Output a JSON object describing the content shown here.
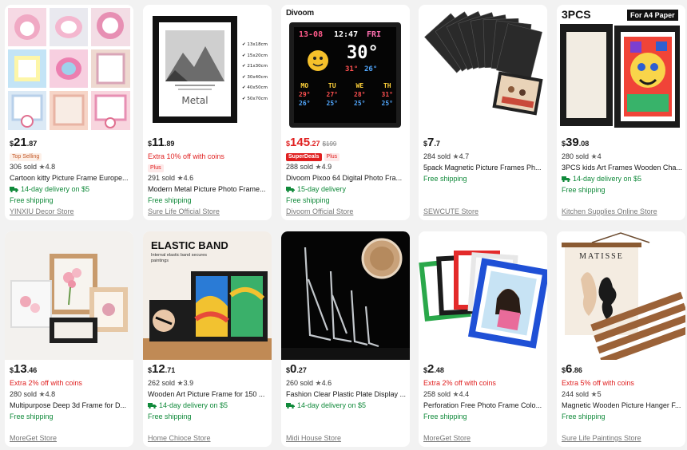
{
  "products": [
    {
      "price_cur": "$",
      "price_main": "21",
      "price_dec": ".87",
      "badges": [
        {
          "kind": "top",
          "text": "Top Selling"
        }
      ],
      "sold": "306 sold",
      "rating": "4.8",
      "title": "Cartoon kitty Picture Frame Europe...",
      "delivery": "14-day delivery on $5",
      "shipping": "Free shipping",
      "store": "YINXIU Decor Store",
      "image_icon": "cartoon-frames-image"
    },
    {
      "price_cur": "$",
      "price_main": "11",
      "price_dec": ".89",
      "promo": "Extra 10% off with coins",
      "badges": [
        {
          "kind": "plus",
          "text": "Plus"
        }
      ],
      "sold": "291 sold",
      "rating": "4.6",
      "title": "Modern Metal Picture Photo Frame...",
      "delivery": "",
      "shipping": "Free shipping",
      "store": "Sure Life Official Store",
      "image_icon": "metal-frame-image",
      "sizes": [
        "13x18cm",
        "15x20cm",
        "21x30cm",
        "30x40cm",
        "40x50cm",
        "50x70cm"
      ],
      "frame_caption": "Metal"
    },
    {
      "price_cur": "$",
      "price_main": "145",
      "price_dec": ".27",
      "price_orig": "$199",
      "price_red": true,
      "badges": [
        {
          "kind": "super",
          "text": "SuperDeals"
        },
        {
          "kind": "plus",
          "text": "Plus"
        }
      ],
      "sold": "288 sold",
      "rating": "4.9",
      "title": "Divoom Pixoo 64 Digital Photo Fra...",
      "delivery": "15-day delivery",
      "shipping": "Free shipping",
      "store": "Divoom Official Store",
      "image_icon": "pixel-display-image",
      "brand": "Divoom",
      "display": {
        "date": "13-08",
        "time": "12:47",
        "day": "FRI",
        "temp": "30°",
        "hi": "31°",
        "lo": "26°",
        "days": [
          "MO",
          "TU",
          "WE",
          "TH"
        ],
        "day_hi": [
          "29°",
          "27°",
          "28°",
          "31°"
        ],
        "day_lo": [
          "26°",
          "25°",
          "25°",
          "25°"
        ]
      }
    },
    {
      "price_cur": "$",
      "price_main": "7",
      "price_dec": ".7",
      "badges": [],
      "sold": "284 sold",
      "rating": "4.7",
      "title": "5pack Magnetic Picture Frames Ph...",
      "delivery": "",
      "shipping": "Free shipping",
      "store": "SEWCUTE Store",
      "image_icon": "magnetic-frames-image"
    },
    {
      "price_cur": "$",
      "price_main": "39",
      "price_dec": ".08",
      "badges": [],
      "sold": "280 sold",
      "rating": "4",
      "title": "3PCS kids Art Frames Wooden Cha...",
      "delivery": "14-day delivery on $5",
      "shipping": "Free shipping",
      "store": "Kitchen Supplies Online Store",
      "image_icon": "kids-art-frame-image",
      "tag_left": "3PCS",
      "tag_right": "For A4 Paper"
    },
    {
      "price_cur": "$",
      "price_main": "13",
      "price_dec": ".46",
      "promo": "Extra 2% off with coins",
      "badges": [],
      "sold": "280 sold",
      "rating": "4.8",
      "title": "Multipurpose Deep 3d Frame for D...",
      "delivery": "",
      "shipping": "Free shipping",
      "store": "MoreGet Store",
      "image_icon": "shadow-box-image"
    },
    {
      "price_cur": "$",
      "price_main": "12",
      "price_dec": ".71",
      "badges": [],
      "sold": "262 sold",
      "rating": "3.9",
      "title": "Wooden Art Picture Frame for 150 ...",
      "delivery": "14-day delivery on $5",
      "shipping": "Free shipping",
      "store": "Home Chioce Store",
      "image_icon": "elastic-band-frame-image",
      "headline": "ELASTIC BAND",
      "subline": "Internal elastic band secures paintings"
    },
    {
      "price_cur": "$",
      "price_main": "0",
      "price_dec": ".27",
      "badges": [],
      "sold": "260 sold",
      "rating": "4.6",
      "title": "Fashion Clear Plastic Plate Display ...",
      "delivery": "14-day delivery on $5",
      "shipping": "",
      "store": "Midi House Store",
      "image_icon": "plate-stand-image"
    },
    {
      "price_cur": "$",
      "price_main": "2",
      "price_dec": ".48",
      "promo": "Extra 2% off with coins",
      "badges": [],
      "sold": "258 sold",
      "rating": "4.4",
      "title": "Perforation Free Photo Frame Colo...",
      "delivery": "",
      "shipping": "Free shipping",
      "store": "MoreGet Store",
      "image_icon": "color-frames-image"
    },
    {
      "price_cur": "$",
      "price_main": "6",
      "price_dec": ".86",
      "promo": "Extra 5% off with coins",
      "badges": [],
      "sold": "244 sold",
      "rating": "5",
      "title": "Magnetic Wooden Picture Hanger F...",
      "delivery": "",
      "shipping": "Free shipping",
      "store": "Sure Life Paintings Store",
      "image_icon": "poster-hanger-image",
      "poster_title": "MATISSE"
    }
  ],
  "colors": {
    "price_red": "#e02020",
    "green": "#118a3b",
    "store_gray": "#777777",
    "background": "#f2f2f2"
  },
  "icons": {
    "star": "star-icon",
    "delivery": "truck-icon"
  }
}
